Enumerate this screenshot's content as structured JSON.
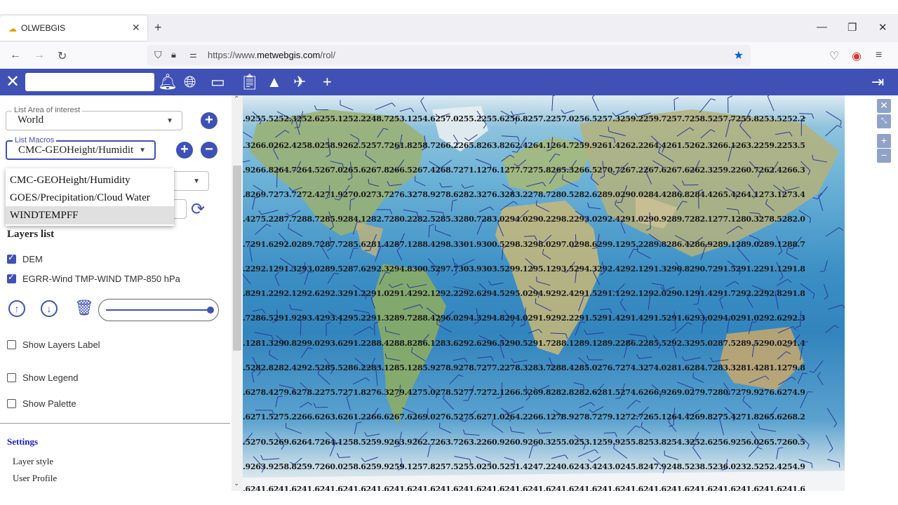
{
  "browser": {
    "tab_title": "OLWEBGIS",
    "new_tab": "+",
    "tab_close": "✕",
    "url_host_prefix": "https://www.",
    "url_host": "metwebgis.com",
    "url_path": "/rol/",
    "window_minimize": "—",
    "window_restore": "❐",
    "window_close": "✕"
  },
  "toolbar": {
    "close_icon": "✕",
    "search_value": "",
    "icons": [
      "bell-icon",
      "globe-icon",
      "panel-icon",
      "clipboard-icon",
      "shapes-icon",
      "airplane-icon",
      "plus-icon",
      "logout-icon"
    ],
    "accent": "#3f51b5"
  },
  "sidebar": {
    "area_legend": "List Area of interest",
    "area_value": "World",
    "macros_legend": "List Macros",
    "macros_value": "CMC-GEOHeight/Humidit",
    "dropdown_options": [
      "CMC-GEOHeight/Humidity",
      "GOES/Precipitation/Cloud Water",
      "WINDTEMPFF"
    ],
    "dropdown_highlighted": "WINDTEMPFF",
    "layers_heading": "Layers list",
    "layers": [
      {
        "label": "DEM",
        "checked": true
      },
      {
        "label": "EGRR-Wind TMP-WIND TMP-850 hPa",
        "checked": true
      }
    ],
    "show_layers_label": "Show Layers Label",
    "show_legend": "Show Legend",
    "show_palette": "Show Palette",
    "settings_heading": "Settings",
    "settings_items": [
      "Layer style",
      "User Profile"
    ],
    "opacity_percent": 100
  },
  "map": {
    "rows": [
      ".9255.5252.3252.6255.1252.2248.7253.1254.6257.0255.2255.6256.8257.2257.0256.5257.3259.2259.7257.7258.5257.7255.8253.5252.2",
      ".3266.0262.4258.0258.9262.5257.7261.8258.7266.2265.8263.8262.4264.1264.7259.9261.4262.2264.4261.5262.3266.1263.2259.2253.5",
      ".9266.8264.7264.5267.0265.6267.8266.5267.4268.7271.1276.1277.7275.8265.3266.5270.7267.2267.6267.6262.3259.2260.7262.4266.3",
      ".8269.7273.7272.4271.9270.0273.7276.3278.9278.6282.3276.3283.2278.7280.5282.6289.0290.0284.4286.8284.4265.4264.1273.1273.4",
      ".4275.2287.7288.7285.9284.1282.7280.2282.5285.3280.7283.0294.0290.2298.2293.0292.4291.0290.9289.7282.1277.1280.3278.5282.0",
      ".7291.6292.0289.7287.7285.6281.4287.1288.4298.3301.9300.5298.3298.0297.0298.6299.1295.2289.8286.4286.9289.1289.0289.1288.7",
      ".2292.1291.3293.0289.5287.6292.3294.8300.5297.7303.9303.5299.1295.1293.5294.3292.4292.1291.3290.8290.7291.5291.2291.1291.8",
      ".8291.2292.1292.6292.3291.2291.0291.4292.1292.2292.6294.5295.0294.9292.4291.5291.1292.1292.0290.1291.4291.7292.2292.8291.8",
      ".7286.5291.9293.4293.4295.2291.3289.7288.4296.0294.3294.8294.0291.9292.2291.5291.4291.4291.5291.6293.0294.0291.0292.6292.3",
      ".1281.3290.8299.0293.6291.2288.4288.8286.1283.6292.6296.5290.5291.7288.1289.1289.2286.2285.5292.3295.0287.5289.5290.0291.4",
      ".5282.8282.4292.5285.5286.2283.1285.1285.9278.9278.7277.2278.3283.7288.4285.0276.7274.3274.0281.6284.7283.3281.4281.1279.8",
      ".6278.4279.6278.2275.7271.8276.3279.4275.0278.5277.7272.1266.5269.8282.8282.6281.5274.6266.9269.0279.7280.7279.9276.6274.9",
      ".6271.5275.2266.6263.6261.2266.6267.6269.0276.5275.6271.0264.2266.1278.9278.7279.1272.7265.1264.4269.8275.4271.8265.6268.2",
      ".5270.5269.6264.7264.1258.5259.9263.9262.7263.7263.2260.9260.9260.3255.0253.1259.9255.8253.8254.3252.6256.9256.0265.7260.5",
      ".9263.9258.8259.7260.0258.6259.9259.1257.8257.5255.0250.5251.4247.2240.6243.4243.0245.8247.9248.5238.5236.0232.5252.4254.9",
      ".6241.6241.6241.6241.6241.6241.6241.6241.6241.6241.6241.6241.6241.6241.6241.6241.6241.6241.6241.6241.6241.6241.6241.6241.6"
    ],
    "controls": [
      "close-icon",
      "shrink-icon",
      "zoom-in-icon",
      "zoom-out-icon"
    ]
  }
}
